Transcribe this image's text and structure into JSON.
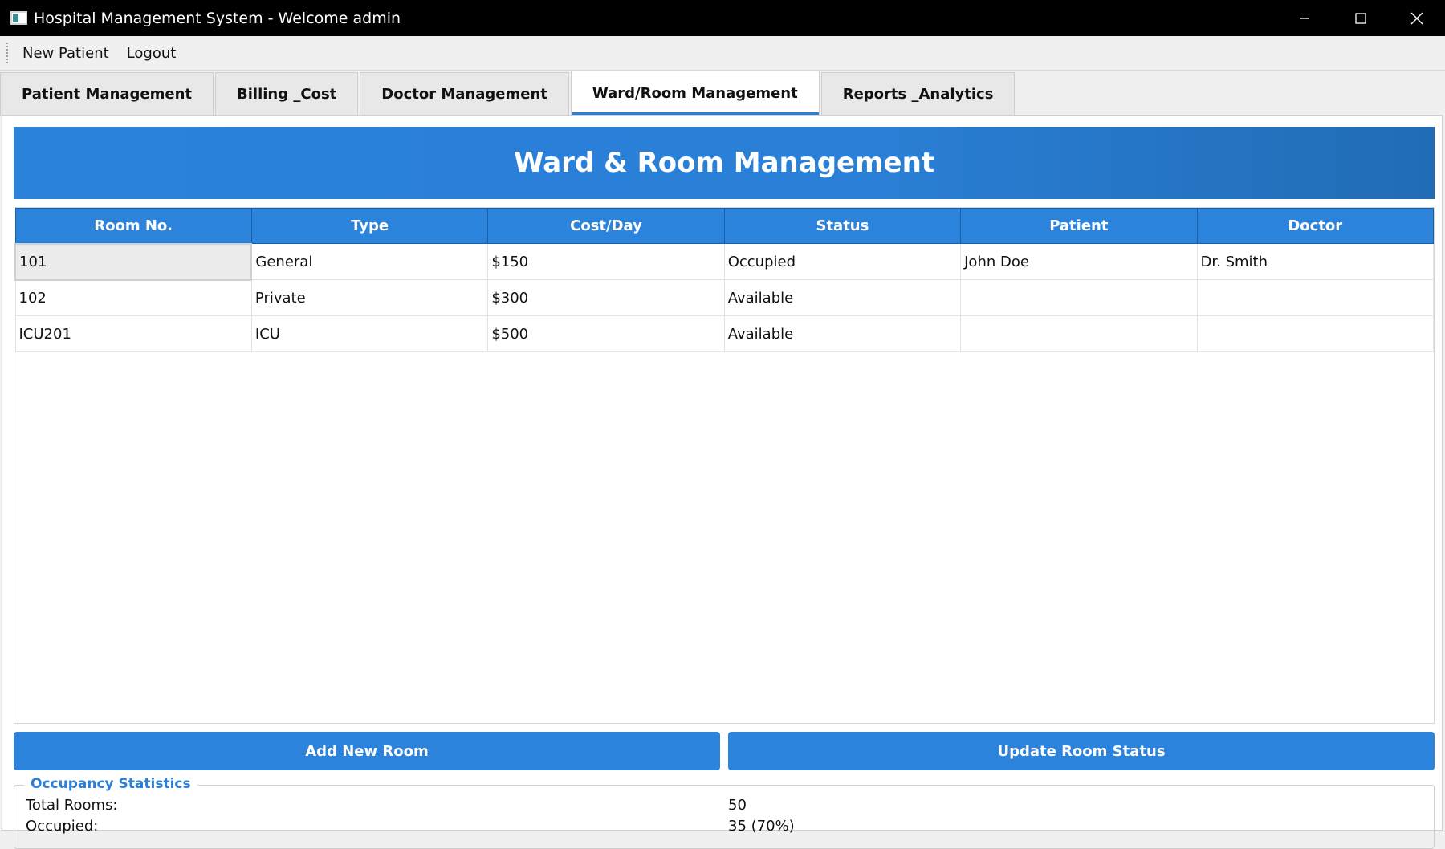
{
  "window": {
    "title": "Hospital Management System - Welcome admin"
  },
  "menu": {
    "items": [
      "New Patient",
      "Logout"
    ]
  },
  "tabs": [
    {
      "label": "Patient Management",
      "active": false
    },
    {
      "label": "Billing _Cost",
      "active": false
    },
    {
      "label": "Doctor Management",
      "active": false
    },
    {
      "label": "Ward/Room Management",
      "active": true
    },
    {
      "label": "Reports _Analytics",
      "active": false
    }
  ],
  "main": {
    "banner_title": "Ward & Room Management",
    "table": {
      "columns": [
        "Room No.",
        "Type",
        "Cost/Day",
        "Status",
        "Patient",
        "Doctor"
      ],
      "rows": [
        [
          "101",
          "General",
          "$150",
          "Occupied",
          "John Doe",
          "Dr. Smith"
        ],
        [
          "102",
          "Private",
          "$300",
          "Available",
          "",
          ""
        ],
        [
          "ICU201",
          "ICU",
          "$500",
          "Available",
          "",
          ""
        ]
      ]
    },
    "buttons": {
      "add_room": "Add New Room",
      "update_status": "Update Room Status"
    },
    "stats": {
      "legend": "Occupancy Statistics",
      "total_label": "Total Rooms:",
      "total_value": "50",
      "occupied_label": "Occupied:",
      "occupied_value": "35 (70%)"
    }
  },
  "colors": {
    "accent": "#2b83dc",
    "titlebar": "#000000"
  },
  "icons": [
    "app-icon",
    "minimize-icon",
    "maximize-icon",
    "close-icon"
  ]
}
